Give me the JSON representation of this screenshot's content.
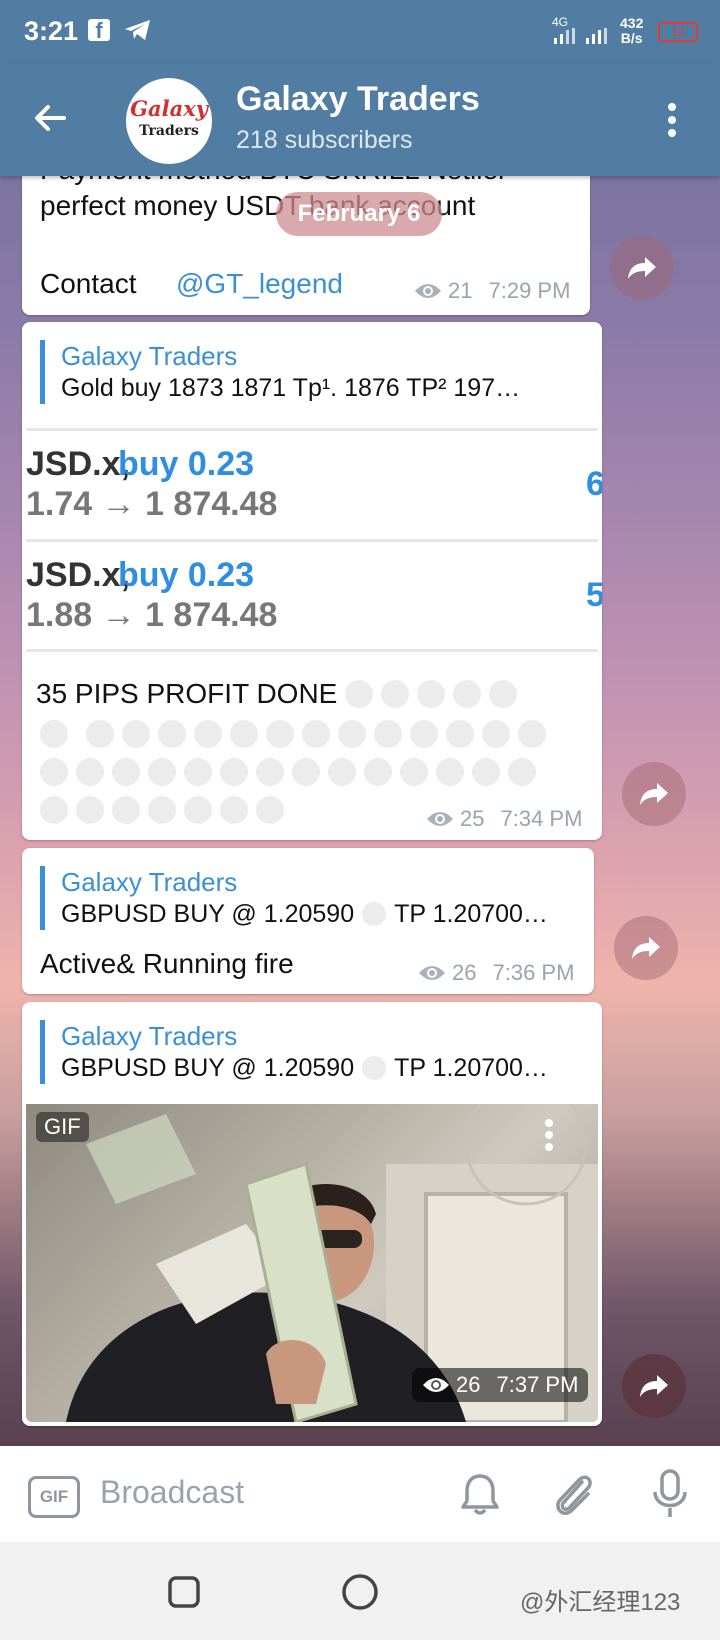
{
  "status_bar": {
    "time": "3:21",
    "network_label": "4G",
    "speed_value": "432",
    "speed_unit": "B/s",
    "battery": "12"
  },
  "header": {
    "channel_name": "Galaxy Traders",
    "subscribers": "218 subscribers",
    "avatar_line1": "Galaxy",
    "avatar_line2": "Traders"
  },
  "date_pill": "February 6",
  "messages": [
    {
      "text_line0": "Payment method BTC SKRILL Netller",
      "text_line1": "perfect money USDT bank account",
      "contact_label": "Contact",
      "contact_handle": "@GT_legend",
      "views": "21",
      "time": "7:29 PM"
    },
    {
      "reply_name": "Galaxy Traders",
      "reply_text": "Gold buy 1873 1871   Tp¹. 1876 TP² 197…",
      "trade1_pair": "JSD.x,",
      "trade1_action": "buy 0.23",
      "trade1_prices": "1.74 → 1 874.48",
      "trade1_right": "6",
      "trade2_pair": "JSD.x,",
      "trade2_action": "buy 0.23",
      "trade2_prices": "1.88 → 1 874.48",
      "trade2_right": "5",
      "text": "35 PIPS PROFIT DONE",
      "views": "25",
      "time": "7:34 PM"
    },
    {
      "reply_name": "Galaxy Traders",
      "reply_text_a": "GBPUSD BUY @ 1.20590",
      "reply_text_b": "TP 1.20700…",
      "text": "Active& Running fire",
      "views": "26",
      "time": "7:36 PM"
    },
    {
      "reply_name": "Galaxy Traders",
      "reply_text_a": "GBPUSD BUY @ 1.20590",
      "reply_text_b": "TP 1.20700…",
      "gif_badge": "GIF",
      "views": "26",
      "time": "7:37 PM"
    }
  ],
  "composer": {
    "gif_label": "GIF",
    "placeholder": "Broadcast"
  },
  "watermark": "@外汇经理123",
  "colors": {
    "header": "#517da2",
    "accent_link": "#3a8fd8",
    "battery_low": "#e53935"
  }
}
